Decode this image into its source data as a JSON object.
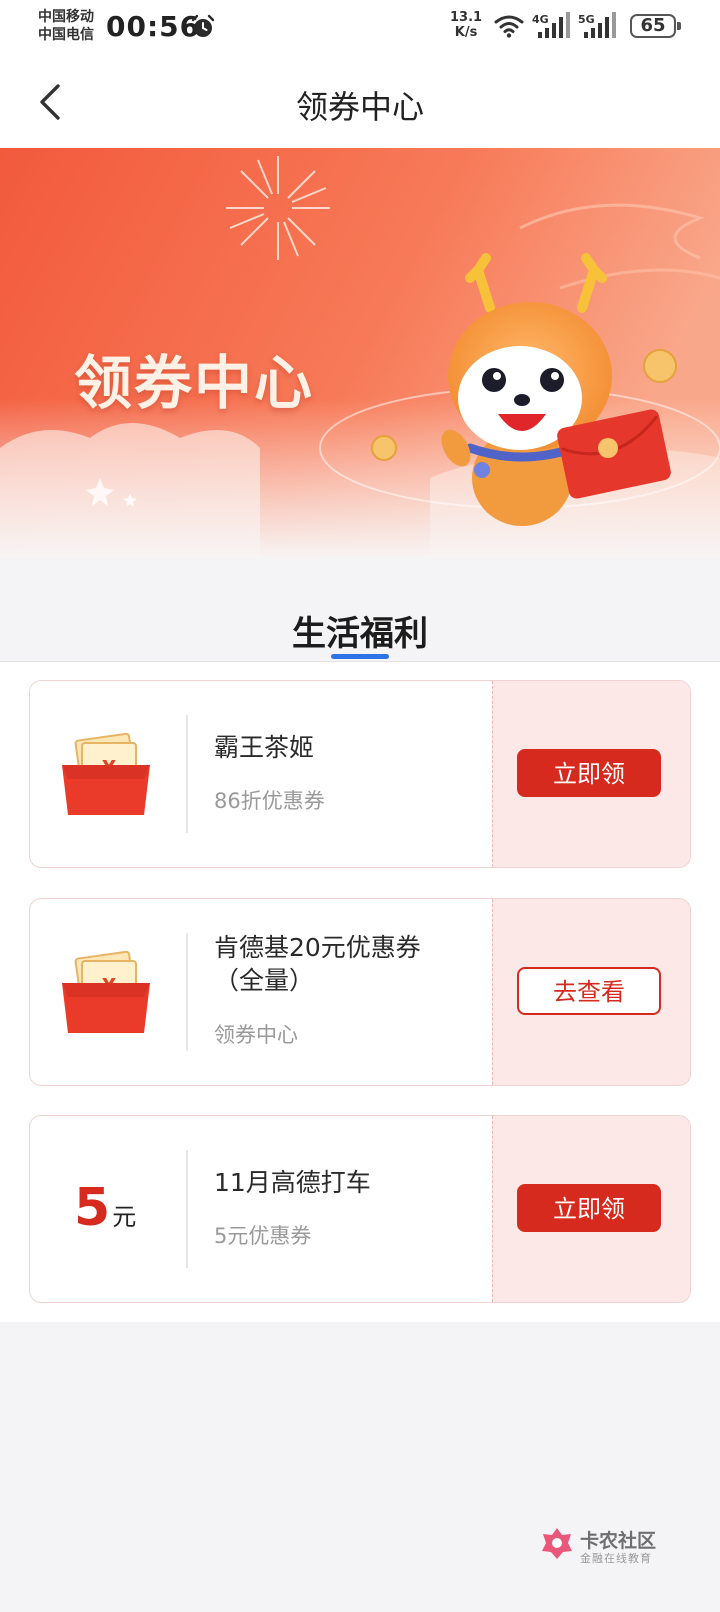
{
  "status_bar": {
    "carrier_1": "中国移动",
    "carrier_2": "中国电信",
    "time": "00:56",
    "speed_value": "13.1",
    "speed_unit": "K/s",
    "network_1": "4G",
    "network_2": "5G",
    "battery": "65"
  },
  "header": {
    "title": "领券中心"
  },
  "banner": {
    "title": "领券中心"
  },
  "section": {
    "title": "生活福利"
  },
  "coupons": [
    {
      "name": "霸王茶姬",
      "desc": "86折优惠券",
      "button": "立即领",
      "icon": "red-envelope-icon"
    },
    {
      "name": "肯德基20元优惠券（全量）",
      "desc": "领券中心",
      "button": "去查看",
      "icon": "red-envelope-icon"
    },
    {
      "name": "11月高德打车",
      "desc": "5元优惠券",
      "button": "立即领",
      "amount": "5",
      "amount_unit": "元"
    }
  ],
  "watermark": {
    "name": "卡农社区",
    "sub": "金融在线教育"
  },
  "colors": {
    "accent_red": "#d52a1d",
    "tab_indicator": "#2f74e6",
    "coupon_right_bg": "#fbe8e7"
  }
}
